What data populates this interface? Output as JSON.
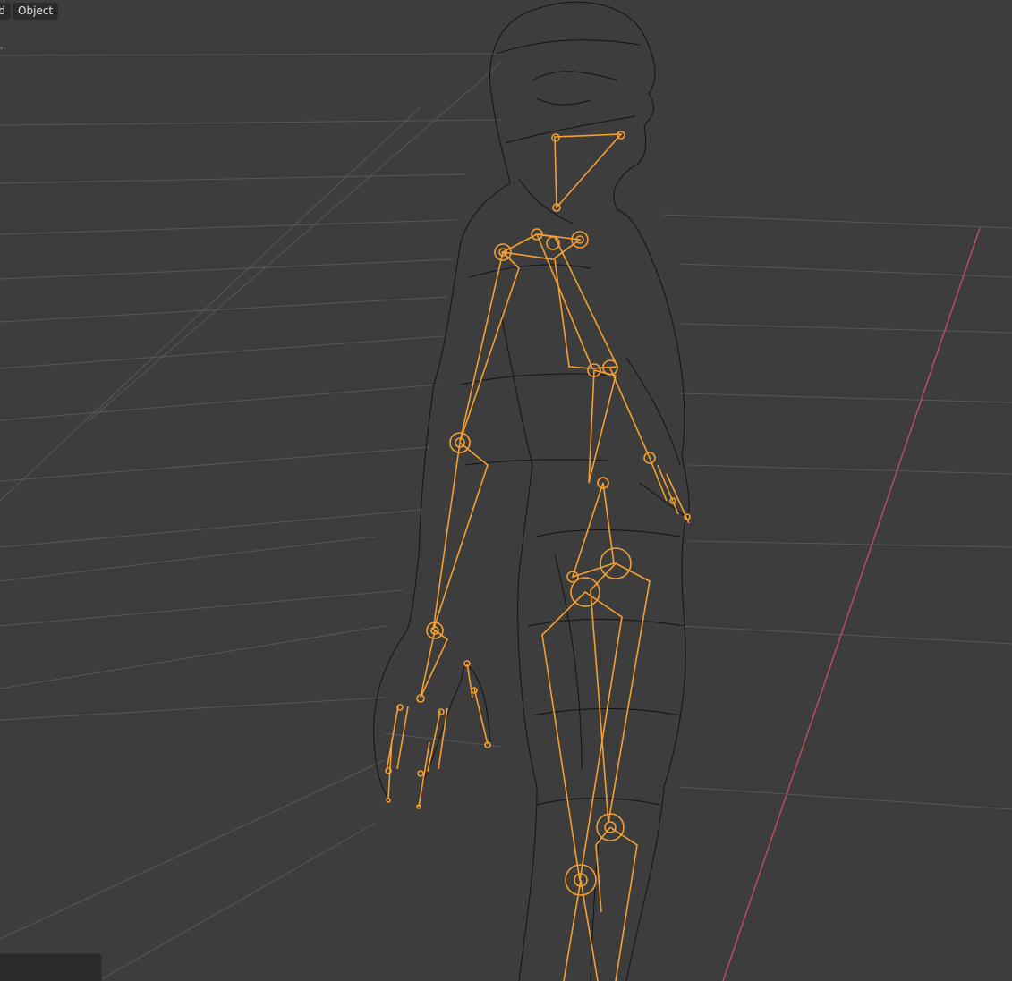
{
  "header": {
    "menus": [
      {
        "label": "ld"
      },
      {
        "label": "Object"
      }
    ]
  },
  "viewport": {
    "background": "#3d3d3d",
    "grid_color": "#585858",
    "x_axis_color": "#c44d5b",
    "mesh_color": "#101010",
    "armature_color": "#f5a030"
  }
}
